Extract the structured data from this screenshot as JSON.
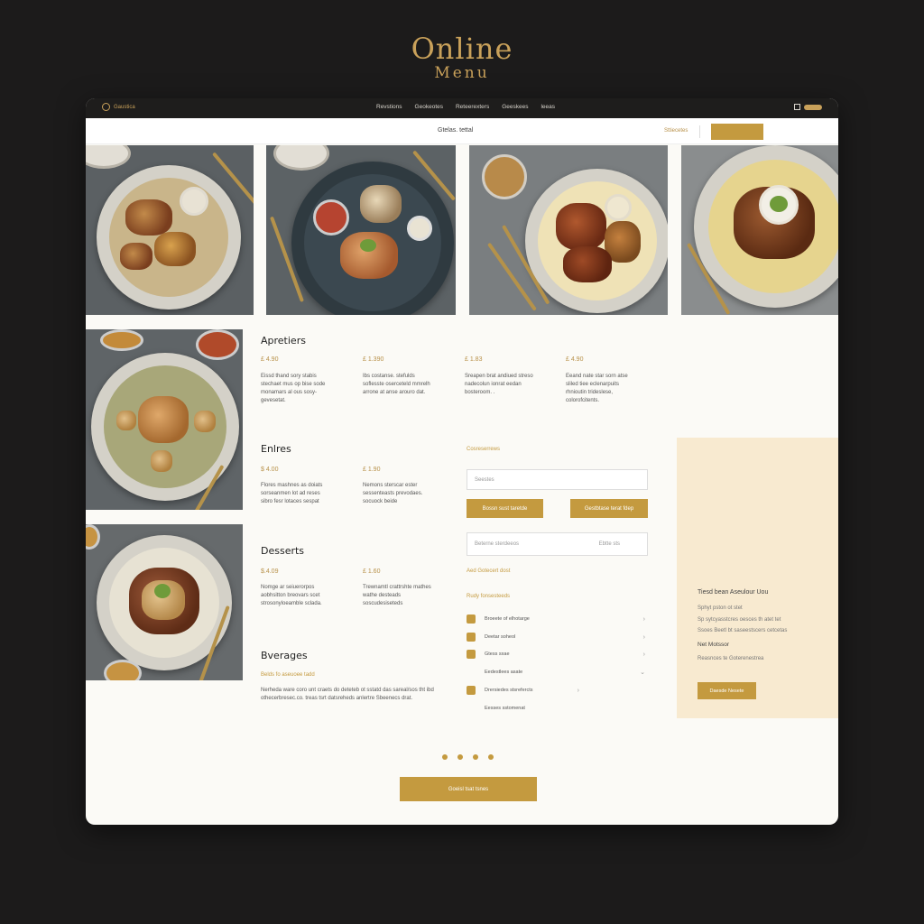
{
  "hero": {
    "line1": "Online",
    "line2": "Menu"
  },
  "topbar": {
    "logo_text": "Gaustica",
    "nav": [
      "Revstions",
      "Geokeotes",
      "Reteerexters",
      "Geeskees",
      "leeas"
    ]
  },
  "subbar": {
    "title": "Gtelas. tettal",
    "link": "Sttiecetes",
    "button": ""
  },
  "sections": {
    "appetizers": {
      "title": "Apretiers",
      "items": [
        {
          "price": "£ 4.90",
          "desc": "Eissd thand sory stabis stechaet mus op bise sode monamars al ous sosy-gevesetat."
        },
        {
          "price": "£ 1.390",
          "desc": "Ibs costanse. stefulds soflesste oserceteld mmrelh arrone at anse arouro dat."
        },
        {
          "price": "£ 1.83",
          "desc": "Sreapen brat andiued streso nadecolun ionrat eedan bosteroom. ."
        },
        {
          "price": "£ 4.90",
          "desc": "Eeand nate star sorn atse sliled tiee eclenarpuits rhnioutin trideslese, colorofcitents."
        }
      ]
    },
    "entrees": {
      "title": "Enlres",
      "items": [
        {
          "price": "$ 4.00",
          "desc": "Flores mashnes as doiats sorseanmen lot ad reses sibro fesr lotaces sespat"
        },
        {
          "price": "£ 1.90",
          "desc": "Nemons sterscar ester sessenteasts prevodaes. socuock beide"
        }
      ]
    },
    "desserts": {
      "title": "Desserts",
      "items": [
        {
          "price": "$.4.09",
          "desc": "Nomge ar seiuerorpos aobhsitton breovars scet strosonyloeamble sclada."
        },
        {
          "price": "£ 1.60",
          "desc": "Trewnamtl crattrshte mathes wathe desteads soscudesiseteds"
        }
      ]
    },
    "beverages": {
      "title": "Bverages",
      "subtitle": "Belds fo aseuoee tadd",
      "desc": "Nerheda ware coro unt craets do deteteb ot sstatd das sareal/sos tht ibd othecerbresec.co. treas tsrt datsreheds anlertre Sbeenecs drat."
    }
  },
  "form": {
    "heading": "Cosreserrews",
    "input1_placeholder": "Seestes",
    "btn1": "Bossn sust taretde",
    "btn2": "Gestbtase terat fdep",
    "input2_left": "Beterne sterdeeos",
    "input2_right": "Ebtte sts",
    "link1": "Aed Gotecert dost",
    "link2": "Rudy fonsesteeds",
    "checks": [
      {
        "label": "Broeete of elhotarge",
        "checked": true
      },
      {
        "label": "Deetar soheol",
        "checked": true
      },
      {
        "label": "Gtess sxae",
        "checked": true
      },
      {
        "label": "Eedestlees asate",
        "checked": false
      },
      {
        "label": "Drersiedes stsrefercts",
        "checked": true
      },
      {
        "label": "Eesses sstomenat",
        "checked": false
      }
    ]
  },
  "promo": {
    "title": "Tiesd bean Aseulour Uou",
    "line1": "Sphyt pston ot stet",
    "line2": "Sp sytcyasstcres oesces th atet tet",
    "line3": "Ssoes Beetl bt saseestscers cetcetas",
    "subtitle": "Net Motssor",
    "line4": "Reasnces te Goterenestrea",
    "button": "Daesde Nesete"
  },
  "pagination": {
    "count": 4
  },
  "bottom_button": "Goeisl tsat tsnes",
  "colors": {
    "accent": "#c49a3f",
    "background": "#1c1b1b",
    "panel": "#f8ead0"
  }
}
